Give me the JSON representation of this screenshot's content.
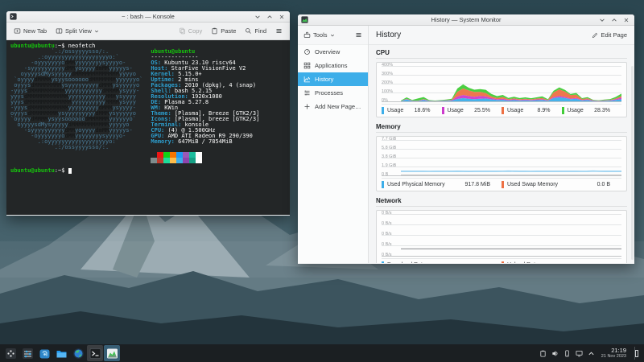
{
  "konsole": {
    "title": "~ : bash — Konsole",
    "toolbar": {
      "new_tab": "New Tab",
      "split_view": "Split View",
      "copy": "Copy",
      "paste": "Paste",
      "find": "Find"
    },
    "terminal": {
      "prompt_user": "ubuntu@ubuntu",
      "prompt_suffix": ":~$ ",
      "command": "neofetch",
      "ascii_art": [
        "            `.:/ossyyyysso/:.",
        "        .:oyyyyyyyyyyyyyyyyyyo:`",
        "      -oyyyyyyyodMMyyyyyyyysyyyyo-",
        "    -syyyyyyyyyydMMyoyyyydmMMyyyyys-",
        "   oyyyysdMysyyyyydMMMMMMMMMMMMMyyyyo",
        " `oyyyydMMMMysyysoooooodMMMMMMMyyyyyyo`",
        " oyyysdMMMMMMMMysyyyyyyyyydMMMysyyyyyo",
        "-yyysdMMMMMMMMMMyyyyyyyyyyydMMMMysyyy-",
        "yyysdMMMMMMMMMMMMyyyyyyyyyyyMMMysyyyy",
        "yyysdMMMMMMMMMMMMMyyyyyyyyyyMMMMysyyy",
        "-yyysdMMMMMMMMMMMyyyyyyyyydMMMysyyyy-",
        "oyyysdMMMMMMMMysyyyyyyyyydMMMysyyyyyo",
        "`oyyyydMMMMysyysoooooodMMMMMMyyyyyyo`",
        "  oyyyysdMysyyyyydMMMMMMMMMMMyyyyyo",
        "    -syyyyyyyyyydMMyoyyyydmMMyyyyys-",
        "      -oyyyyyyyodMMyyyyyyyysyyyyo-",
        "        .:oyyyyyyyyyyyyyyyyyyo:`",
        "            `.:/ossyyyysso/:."
      ],
      "info_header": "ubuntu@ubuntu",
      "info_separator": "--------------",
      "info_lines": [
        {
          "label": "OS",
          "value": "Kubuntu 23.10 riscv64"
        },
        {
          "label": "Host",
          "value": "StarFive VisionFive V2"
        },
        {
          "label": "Kernel",
          "value": "5.15.0+"
        },
        {
          "label": "Uptime",
          "value": "2 mins"
        },
        {
          "label": "Packages",
          "value": "2010 (dpkg), 4 (snap)"
        },
        {
          "label": "Shell",
          "value": "bash 5.2.15"
        },
        {
          "label": "Resolution",
          "value": "1920x1080"
        },
        {
          "label": "DE",
          "value": "Plasma 5.27.8"
        },
        {
          "label": "WM",
          "value": "KWin"
        },
        {
          "label": "Theme",
          "value": "[Plasma], Breeze [GTK2/3]"
        },
        {
          "label": "Icons",
          "value": "[Plasma], breeze [GTK2/3]"
        },
        {
          "label": "Terminal",
          "value": "konsole"
        },
        {
          "label": "CPU",
          "value": "(4) @ 1.500GHz"
        },
        {
          "label": "GPU",
          "value": "AMD ATI Radeon R9 290/390"
        },
        {
          "label": "Memory",
          "value": "647MiB / 7854MiB"
        }
      ],
      "palette_row1": [
        "#232627",
        "#ed1515",
        "#11d116",
        "#f67400",
        "#1d99f3",
        "#9b59b6",
        "#1abc9c",
        "#fcfcfc"
      ],
      "palette_row2": [
        "#7f8c8d",
        "#c0392b",
        "#1cdc9a",
        "#fdbc4b",
        "#3daee9",
        "#8e44ad",
        "#16a085",
        "#ffffff"
      ]
    }
  },
  "sysmon": {
    "title": "History — System Monitor",
    "tools_label": "Tools",
    "page_title": "History",
    "edit_label": "Edit Page",
    "sidebar": [
      {
        "label": "Overview",
        "icon": "overview",
        "selected": false
      },
      {
        "label": "Applications",
        "icon": "applications",
        "selected": false
      },
      {
        "label": "History",
        "icon": "history",
        "selected": true
      },
      {
        "label": "Processes",
        "icon": "processes",
        "selected": false
      },
      {
        "label": "Add New Page…",
        "icon": "add",
        "selected": false
      }
    ],
    "sections": [
      {
        "title": "CPU"
      },
      {
        "title": "Memory"
      },
      {
        "title": "Network"
      }
    ]
  },
  "chart_data": [
    {
      "type": "area",
      "stacked": true,
      "title": "CPU",
      "ylabels": [
        "400%",
        "300%",
        "200%",
        "100%",
        "0%"
      ],
      "ylim": [
        0,
        400
      ],
      "legend": [
        {
          "label": "Usage",
          "value": "18.6%",
          "color": "#3daee9"
        },
        {
          "label": "Usage",
          "value": "25.5%",
          "color": "#cc3bcc"
        },
        {
          "label": "Usage",
          "value": "8.9%",
          "color": "#ed7044"
        },
        {
          "label": "Usage",
          "value": "28.3%",
          "color": "#41cc38"
        }
      ],
      "series": [
        {
          "name": "Usage",
          "color": "#3daee9",
          "values": [
            3,
            22,
            6,
            4,
            16,
            5,
            3,
            5,
            7,
            9,
            28,
            38,
            30,
            26,
            31,
            34,
            24,
            16,
            18,
            11,
            15,
            11,
            13,
            10,
            14,
            16,
            8,
            38,
            48,
            40,
            26,
            30,
            12,
            16,
            6,
            4,
            7,
            9,
            16,
            26
          ]
        },
        {
          "name": "Usage",
          "color": "#cc3bcc",
          "values": [
            1,
            5,
            2,
            2,
            6,
            2,
            1,
            2,
            3,
            5,
            28,
            36,
            32,
            28,
            32,
            24,
            14,
            10,
            12,
            7,
            9,
            6,
            8,
            7,
            8,
            10,
            4,
            11,
            15,
            12,
            7,
            10,
            4,
            7,
            3,
            2,
            3,
            4,
            9,
            18
          ]
        },
        {
          "name": "Usage",
          "color": "#ed7044",
          "values": [
            1,
            4,
            2,
            2,
            5,
            2,
            1,
            2,
            3,
            5,
            55,
            75,
            65,
            55,
            48,
            38,
            20,
            14,
            20,
            9,
            11,
            9,
            10,
            8,
            10,
            12,
            5,
            55,
            75,
            62,
            40,
            38,
            12,
            13,
            4,
            3,
            4,
            5,
            9,
            18
          ]
        },
        {
          "name": "Usage",
          "color": "#41cc38",
          "values": [
            4,
            16,
            6,
            26,
            23,
            6,
            4,
            5,
            8,
            11,
            38,
            48,
            30,
            26,
            31,
            38,
            28,
            20,
            24,
            13,
            19,
            12,
            16,
            11,
            15,
            20,
            8,
            18,
            24,
            19,
            12,
            20,
            9,
            13,
            5,
            4,
            7,
            9,
            17,
            28
          ]
        }
      ]
    },
    {
      "type": "line",
      "title": "Memory",
      "ylabels": [
        "7.7 GiB",
        "5.8 GiB",
        "3.8 GiB",
        "1.9 GiB",
        "0 B"
      ],
      "ylim": [
        0,
        7.7
      ],
      "legend": [
        {
          "label": "Used Physical Memory",
          "value": "917.8 MiB",
          "color": "#3daee9"
        },
        {
          "label": "Used Swap Memory",
          "value": "0.0 B",
          "color": "#ed7044"
        }
      ],
      "series": [
        {
          "name": "Used Physical Memory",
          "color": "#8fcdf0",
          "values": [
            0.91,
            0.9,
            0.9,
            0.92,
            0.9,
            0.89,
            0.9,
            0.91,
            0.9,
            0.9,
            0.93,
            0.9,
            0.88,
            0.9,
            0.9,
            0.91,
            0.9,
            0.9,
            0.92,
            0.95,
            0.93,
            0.9,
            0.9,
            0.89,
            0.9,
            0.9,
            0.91,
            0.9,
            0.9,
            0.9,
            0.92,
            0.9,
            0.89,
            0.9,
            0.96,
            0.92,
            0.9,
            0.9,
            0.91,
            0.9
          ]
        },
        {
          "name": "Used Swap Memory",
          "color": "#c8cacb",
          "values": [
            0,
            0,
            0,
            0,
            0,
            0,
            0,
            0,
            0,
            0,
            0,
            0,
            0,
            0,
            0,
            0,
            0,
            0,
            0,
            0,
            0,
            0,
            0,
            0,
            0,
            0,
            0,
            0,
            0,
            0,
            0,
            0,
            0,
            0,
            0,
            0,
            0,
            0,
            0,
            0
          ]
        }
      ]
    },
    {
      "type": "line",
      "title": "Network",
      "ylabels": [
        "0 B/s",
        "0 B/s",
        "0 B/s",
        "0 B/s",
        "0 B/s"
      ],
      "ylim": [
        0,
        1
      ],
      "legend": [
        {
          "label": "Download Rate",
          "value": "",
          "color": "#3daee9"
        },
        {
          "label": "Upload Rate",
          "value": "",
          "color": "#ed7044"
        }
      ],
      "series": [
        {
          "name": "Download Rate",
          "color": "#9a9da0",
          "values": [
            0,
            0
          ]
        },
        {
          "name": "Upload Rate",
          "color": "#9a9da0",
          "values": [
            0,
            0
          ]
        }
      ]
    }
  ],
  "taskbar": {
    "left_icons": [
      {
        "name": "app-launcher",
        "state": ""
      },
      {
        "name": "system-settings",
        "state": ""
      },
      {
        "name": "discover",
        "state": ""
      },
      {
        "name": "dolphin",
        "state": ""
      },
      {
        "name": "browser",
        "state": ""
      },
      {
        "name": "konsole",
        "state": "open"
      },
      {
        "name": "system-monitor",
        "state": "active"
      }
    ],
    "tray_icons": [
      "clipboard",
      "volume",
      "media-player",
      "display",
      "caret-up"
    ],
    "clock": {
      "time": "21:19",
      "date": "21 Nov 2023"
    }
  }
}
